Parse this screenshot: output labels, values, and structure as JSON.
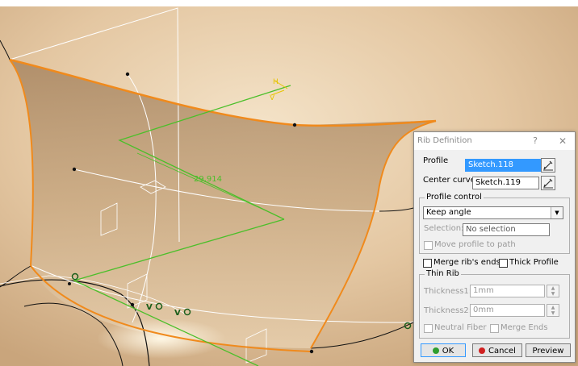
{
  "viewport": {
    "dimension_label": "29,914",
    "axis_labels": {
      "h": "H",
      "v": "V"
    },
    "constraint_labels": [
      "V",
      "V"
    ]
  },
  "dialog": {
    "title": "Rib Definition",
    "help": "?",
    "close": "✕",
    "profile_label": "Profile",
    "profile_value": "Sketch.118",
    "center_curve_label": "Center curve",
    "center_curve_value": "Sketch.119",
    "profile_control": {
      "legend": "Profile control",
      "mode": "Keep angle",
      "selection_label": "Selection:",
      "selection_value": "No selection",
      "move_profile_label": "Move profile to path",
      "move_profile_checked": false
    },
    "merge_ribs_label": "Merge rib's ends",
    "merge_ribs_checked": false,
    "thick_profile_label": "Thick Profile",
    "thick_profile_checked": false,
    "thin_rib": {
      "legend": "Thin Rib",
      "thickness1_label": "Thickness1:",
      "thickness1_value": "1mm",
      "thickness2_label": "Thickness2:",
      "thickness2_value": "0mm",
      "neutral_fiber_label": "Neutral Fiber",
      "merge_ends_label": "Merge Ends"
    },
    "buttons": {
      "ok": "OK",
      "cancel": "Cancel",
      "preview": "Preview"
    },
    "colors": {
      "ok_dot": "#2e9e2e",
      "cancel_dot": "#d02020",
      "selection": "#3399ff"
    }
  }
}
